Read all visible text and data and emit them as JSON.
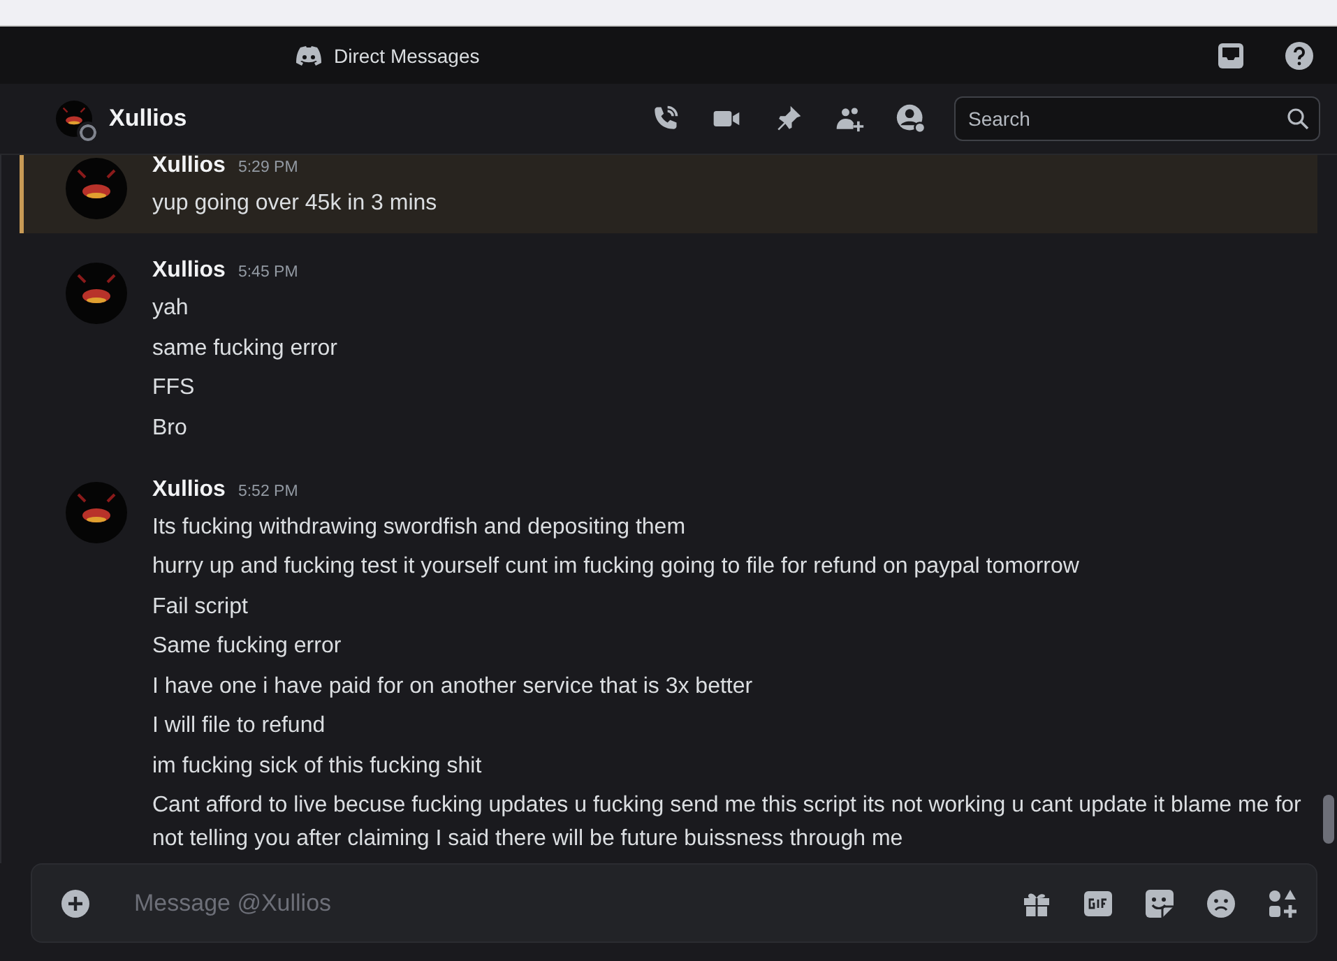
{
  "titlebar": {
    "title": "Direct Messages"
  },
  "header": {
    "name": "Xullios",
    "search": {
      "placeholder": "Search"
    }
  },
  "messages": [
    {
      "author": "Xullios",
      "time": "5:29 PM",
      "highlighted": true,
      "lines": [
        "yup going over 45k in 3 mins"
      ]
    },
    {
      "author": "Xullios",
      "time": "5:45 PM",
      "highlighted": false,
      "lines": [
        "yah",
        "same fucking error",
        "FFS",
        "Bro"
      ]
    },
    {
      "author": "Xullios",
      "time": "5:52 PM",
      "highlighted": false,
      "lines": [
        "Its fucking withdrawing swordfish and depositing them",
        "hurry up and fucking test it yourself cunt im fucking going to file for refund on paypal tomorrow",
        "Fail script",
        "Same fucking error",
        "I have one i have paid for on another service that is 3x better",
        "I will file to refund",
        "im fucking sick of this fucking shit",
        "Cant afford to live becuse fucking updates u fucking send me this script its not working u cant update it blame me for not telling you after claiming I said there will be future buissness through me"
      ]
    }
  ],
  "composer": {
    "placeholder": "Message @Xullios"
  }
}
